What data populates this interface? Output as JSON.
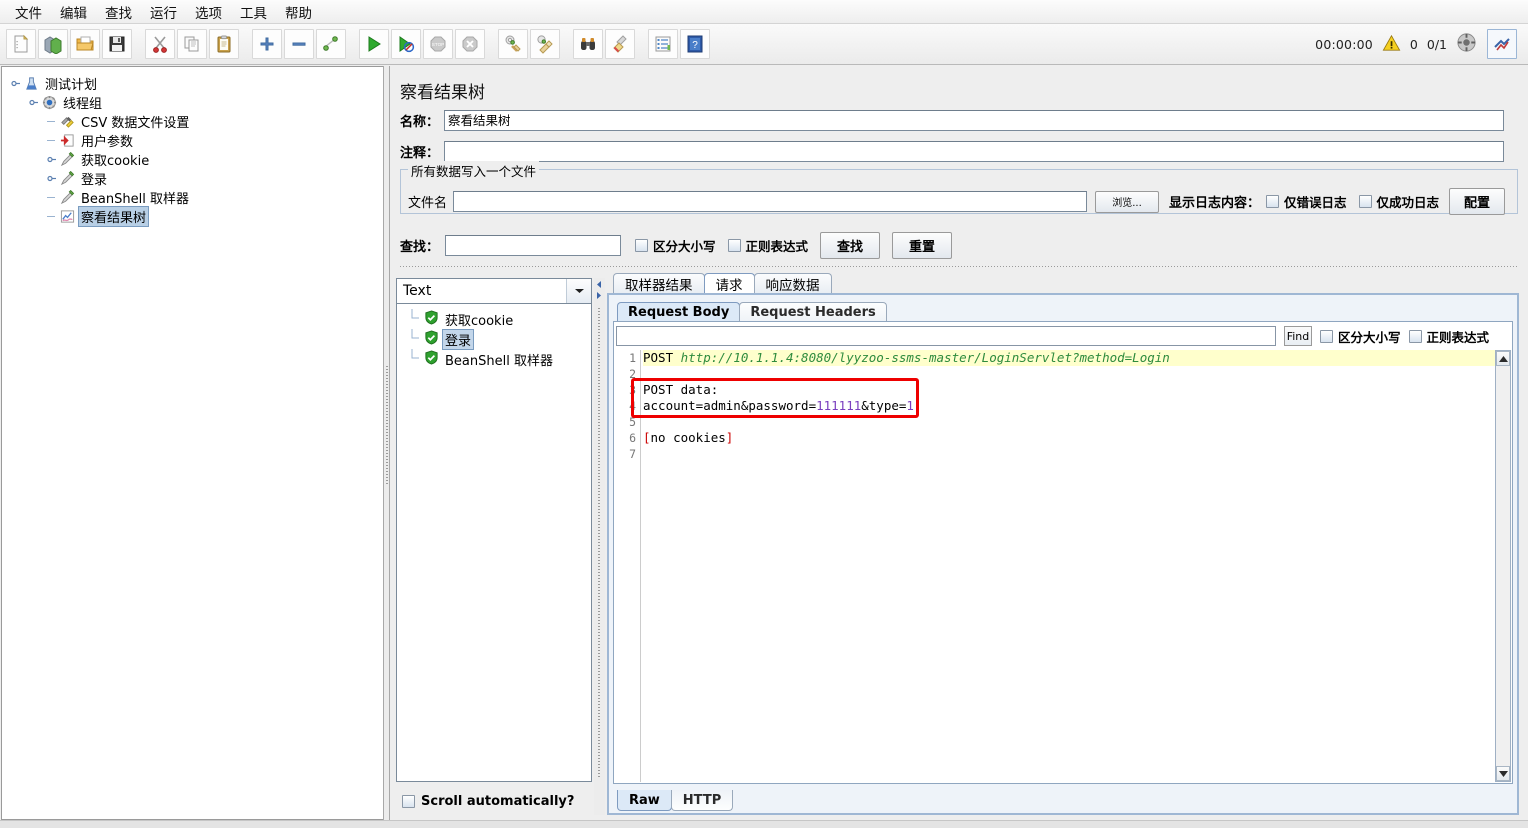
{
  "menu": {
    "items": [
      "文件",
      "编辑",
      "查找",
      "运行",
      "选项",
      "工具",
      "帮助"
    ]
  },
  "toolbar": {
    "buttons": [
      {
        "name": "new-test-plan",
        "icon": "new-file-icon"
      },
      {
        "name": "templates",
        "icon": "templates-icon"
      },
      {
        "name": "open",
        "icon": "open-folder-icon"
      },
      {
        "name": "save",
        "icon": "save-disk-icon"
      },
      {
        "name": "cut",
        "icon": "scissors-icon"
      },
      {
        "name": "copy",
        "icon": "copy-icon"
      },
      {
        "name": "paste",
        "icon": "clipboard-icon"
      },
      {
        "name": "expand-all",
        "icon": "plus-icon"
      },
      {
        "name": "collapse-all",
        "icon": "minus-icon"
      },
      {
        "name": "toggle",
        "icon": "toggle-icon"
      },
      {
        "name": "start",
        "icon": "play-green-icon"
      },
      {
        "name": "start-no-timers",
        "icon": "play-no-timer-icon"
      },
      {
        "name": "stop",
        "icon": "stop-sign-icon"
      },
      {
        "name": "shutdown",
        "icon": "shutdown-icon"
      },
      {
        "name": "clear",
        "icon": "clear-icon"
      },
      {
        "name": "clear-all",
        "icon": "clear-all-icon"
      },
      {
        "name": "search",
        "icon": "binoculars-icon"
      },
      {
        "name": "search-reset",
        "icon": "broom-icon"
      },
      {
        "name": "function-helper",
        "icon": "function-list-icon"
      },
      {
        "name": "help",
        "icon": "help-book-icon"
      }
    ],
    "timer": "00:00:00",
    "error_count": "0",
    "thread_count": "0/1",
    "warning_icon": "warning-triangle-icon",
    "reset_icon": "reset-circle-icon",
    "remote_icon": "remote-engines-icon"
  },
  "tree": {
    "nodes": [
      {
        "label": "测试计划",
        "icon": "test-plan-icon",
        "depth": 0,
        "handle": "expanded",
        "selected": false
      },
      {
        "label": "线程组",
        "icon": "thread-group-icon",
        "depth": 1,
        "handle": "expanded",
        "selected": false
      },
      {
        "label": "CSV 数据文件设置",
        "icon": "csv-data-set-icon",
        "depth": 2,
        "handle": "none",
        "selected": false
      },
      {
        "label": "用户参数",
        "icon": "user-parameters-icon",
        "depth": 2,
        "handle": "none",
        "selected": false
      },
      {
        "label": "获取cookie",
        "icon": "http-sampler-icon",
        "depth": 2,
        "handle": "collapsed",
        "selected": false
      },
      {
        "label": "登录",
        "icon": "http-sampler-icon",
        "depth": 2,
        "handle": "collapsed",
        "selected": false
      },
      {
        "label": "BeanShell 取样器",
        "icon": "http-sampler-icon",
        "depth": 2,
        "handle": "none",
        "selected": false
      },
      {
        "label": "察看结果树",
        "icon": "view-results-tree-icon",
        "depth": 2,
        "handle": "none",
        "selected": true
      }
    ]
  },
  "panel": {
    "title": "察看结果树",
    "name_label": "名称：",
    "name_value": "察看结果树",
    "comment_label": "注释：",
    "comment_value": "",
    "filegroup": {
      "title": "所有数据写入一个文件",
      "filename_label": "文件名",
      "filename_value": "",
      "browse_label": "浏览...",
      "log_display_label": "显示日志内容：",
      "errors_only_label": "仅错误日志",
      "success_only_label": "仅成功日志",
      "configure_label": "配置"
    },
    "search": {
      "label": "查找：",
      "value": "",
      "case_sensitive_label": "区分大小写",
      "regex_label": "正则表达式",
      "find_label": "查找",
      "reset_label": "重置"
    }
  },
  "results": {
    "renderer": "Text",
    "tree_items": [
      {
        "label": "获取cookie",
        "status": "success",
        "selected": false
      },
      {
        "label": "登录",
        "status": "success",
        "selected": true
      },
      {
        "label": "BeanShell 取样器",
        "status": "success",
        "selected": false
      }
    ],
    "scroll_label": "Scroll automatically?",
    "tabs": [
      {
        "label": "取样器结果",
        "active": false
      },
      {
        "label": "请求",
        "active": true
      },
      {
        "label": "响应数据",
        "active": false
      }
    ],
    "subtabs": [
      {
        "label": "Request Body",
        "active": true
      },
      {
        "label": "Request Headers",
        "active": false
      }
    ],
    "find": {
      "value": "",
      "find_label": "Find",
      "case_sensitive_label": "区分大小写",
      "regex_label": "正则表达式"
    },
    "bottom_tabs": [
      {
        "label": "Raw",
        "active": true
      },
      {
        "label": "HTTP",
        "active": false
      }
    ],
    "code": {
      "line_numbers": [
        "1",
        "2",
        "3",
        "4",
        "5",
        "6",
        "7"
      ],
      "lines": [
        {
          "text": "POST http://10.1.1.4:8080/lyyzoo-ssms-master/LoginServlet?method=Login",
          "highlight": true,
          "style": "request-line"
        },
        {
          "text": "",
          "highlight": false,
          "style": "plain"
        },
        {
          "text": "POST data:",
          "highlight": false,
          "style": "plain"
        },
        {
          "text": "account=admin&password=111111&type=1",
          "highlight": false,
          "style": "post-data"
        },
        {
          "text": "",
          "highlight": false,
          "style": "plain"
        },
        {
          "text": "[no cookies]",
          "highlight": false,
          "style": "cookies"
        },
        {
          "text": "",
          "highlight": false,
          "style": "plain"
        }
      ],
      "annotation_color": "#ee0000",
      "highlight_color": "#ffffcc"
    }
  },
  "colors": {
    "background": "#eeeeee",
    "panel_border": "#9fb7d4",
    "tab_active": "#dce9f7",
    "success_green": "#2ea02e",
    "annotation_red": "#ee0000"
  }
}
